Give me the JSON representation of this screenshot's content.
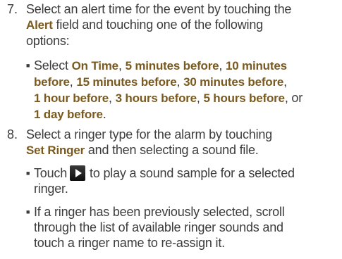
{
  "step7": {
    "number": "7.",
    "text_a": "Select an alert time for the event by touching the",
    "alert_label": "Alert",
    "text_b": " field and touching one of the following",
    "text_c": "options:",
    "bullet": {
      "select": "Select ",
      "on_time": "On Time",
      "comma": ", ",
      "five_min": "5 minutes before",
      "ten_min": "10 minutes",
      "ten_min_2": "before",
      "fifteen_min": "15 minutes before",
      "thirty_min": "30 minutes before",
      "one_hour": "1 hour before",
      "three_hours": "3 hours before",
      "five_hours": "5 hours before",
      "or": ", or",
      "one_day": "1 day before",
      "period": "."
    }
  },
  "step8": {
    "number": "8.",
    "text_a": "Select a ringer type for the alarm by touching",
    "set_ringer": "Set Ringer",
    "text_b": " and then selecting a sound file.",
    "bullet1": {
      "touch": "Touch",
      "text": "to play a sound sample for a selected",
      "text_2": "ringer."
    },
    "bullet2": {
      "line1": "If a ringer has been previously selected, scroll",
      "line2": "through the list of available ringer sounds and",
      "line3": "touch a ringer name to re-assign it."
    }
  },
  "icons": {
    "play": "play-icon"
  },
  "colors": {
    "body_text": "#3c3c3c",
    "highlight": "#7a5a1f",
    "icon_bg": "#1c1c1c"
  }
}
